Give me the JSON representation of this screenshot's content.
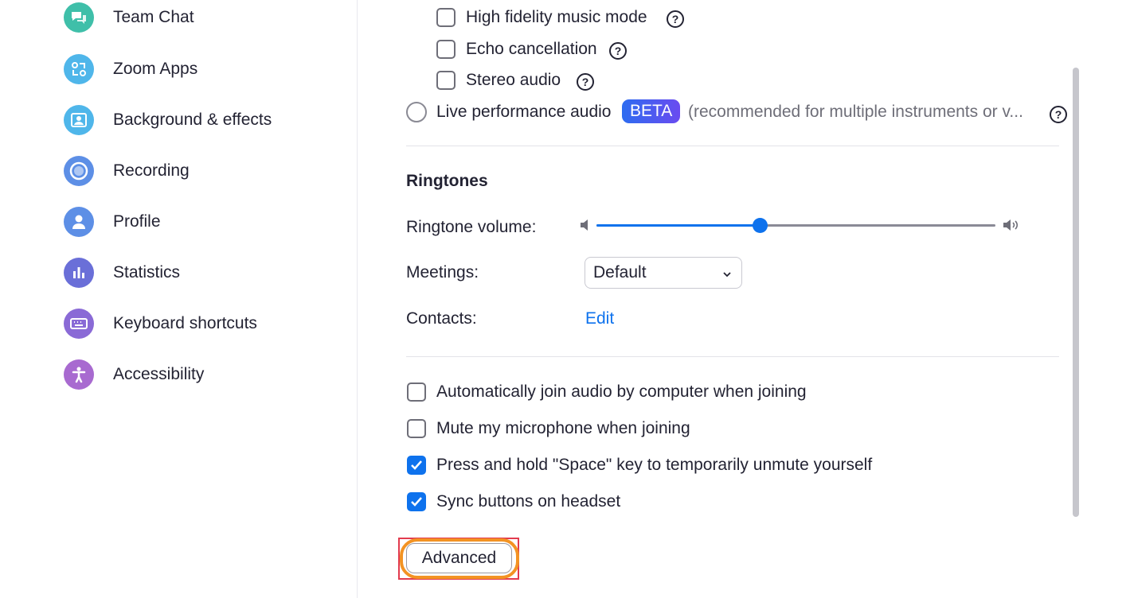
{
  "sidebar": {
    "items": [
      {
        "label": "Team Chat",
        "icon": "chat-icon",
        "color": "#3fbfa9"
      },
      {
        "label": "Zoom Apps",
        "icon": "apps-icon",
        "color": "#4fb6ea"
      },
      {
        "label": "Background & effects",
        "icon": "background-icon",
        "color": "#4fb6ea"
      },
      {
        "label": "Recording",
        "icon": "recording-icon",
        "color": "#5d8fe6"
      },
      {
        "label": "Profile",
        "icon": "profile-icon",
        "color": "#5d8fe6"
      },
      {
        "label": "Statistics",
        "icon": "statistics-icon",
        "color": "#6a6fd8"
      },
      {
        "label": "Keyboard shortcuts",
        "icon": "keyboard-icon",
        "color": "#8a6ad6"
      },
      {
        "label": "Accessibility",
        "icon": "accessibility-icon",
        "color": "#a86ad0"
      }
    ]
  },
  "audio_options": {
    "high_fidelity": {
      "label": "High fidelity music mode",
      "checked": false
    },
    "echo_cancellation": {
      "label": "Echo cancellation",
      "checked": false
    },
    "stereo_audio": {
      "label": "Stereo audio",
      "checked": false
    },
    "live_performance": {
      "label": "Live performance audio",
      "badge": "BETA",
      "note": "(recommended for multiple instruments or v...",
      "selected": false
    }
  },
  "ringtones": {
    "heading": "Ringtones",
    "volume_label": "Ringtone volume:",
    "volume_level": 0.41,
    "meetings_label": "Meetings:",
    "meetings_value": "Default",
    "contacts_label": "Contacts:",
    "contacts_link": "Edit"
  },
  "join_options": [
    {
      "label": "Automatically join audio by computer when joining",
      "checked": false
    },
    {
      "label": "Mute my microphone when joining",
      "checked": false
    },
    {
      "label": "Press and hold \"Space\" key to temporarily unmute yourself",
      "checked": true
    },
    {
      "label": "Sync buttons on headset",
      "checked": true
    }
  ],
  "advanced_button": "Advanced",
  "help_glyph": "?",
  "colors": {
    "accent": "#0e72ed",
    "highlight_ring": "#f39323",
    "highlight_box": "#e23b4e"
  }
}
